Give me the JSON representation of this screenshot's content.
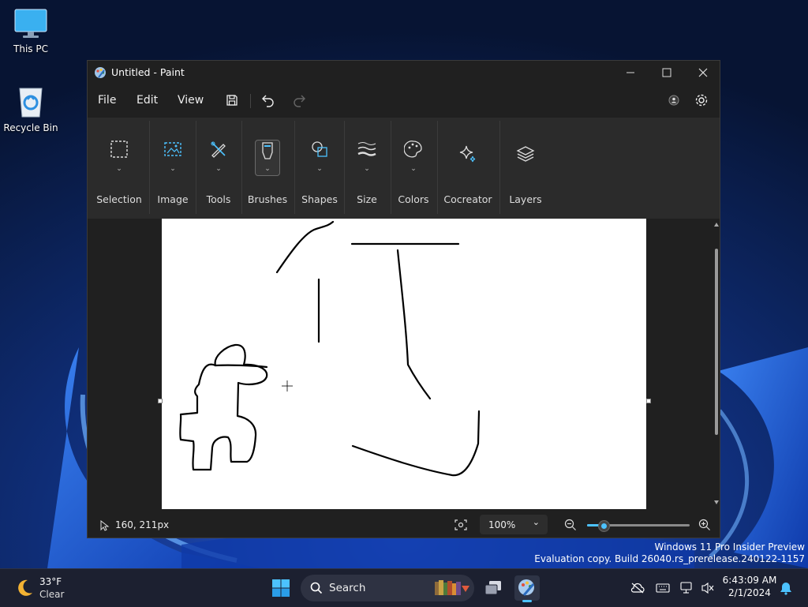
{
  "desktop": {
    "icons": [
      {
        "label": "This PC"
      },
      {
        "label": "Recycle Bin"
      }
    ]
  },
  "window": {
    "title": "Untitled - Paint",
    "menu": [
      "File",
      "Edit",
      "View"
    ],
    "ribbon": [
      "Selection",
      "Image",
      "Tools",
      "Brushes",
      "Shapes",
      "Size",
      "Colors",
      "Cocreator",
      "Layers"
    ],
    "selected_tool": "Brushes"
  },
  "status": {
    "cursor_position": "160, 211px",
    "zoom": "100%",
    "zoom_slider_level": 0.17
  },
  "watermark": {
    "line1": "Windows 11 Pro Insider Preview",
    "line2": "Evaluation copy. Build 26040.rs_prerelease.240122-1157"
  },
  "taskbar": {
    "weather_temp": "33°F",
    "weather_cond": "Clear",
    "search_label": "Search",
    "time": "6:43:09 AM",
    "date": "2/1/2024"
  },
  "colors": {
    "accent": "#4cc2ff",
    "window_bg": "#202020",
    "ribbon_bg": "#2b2b2b",
    "canvas": "#ffffff"
  }
}
